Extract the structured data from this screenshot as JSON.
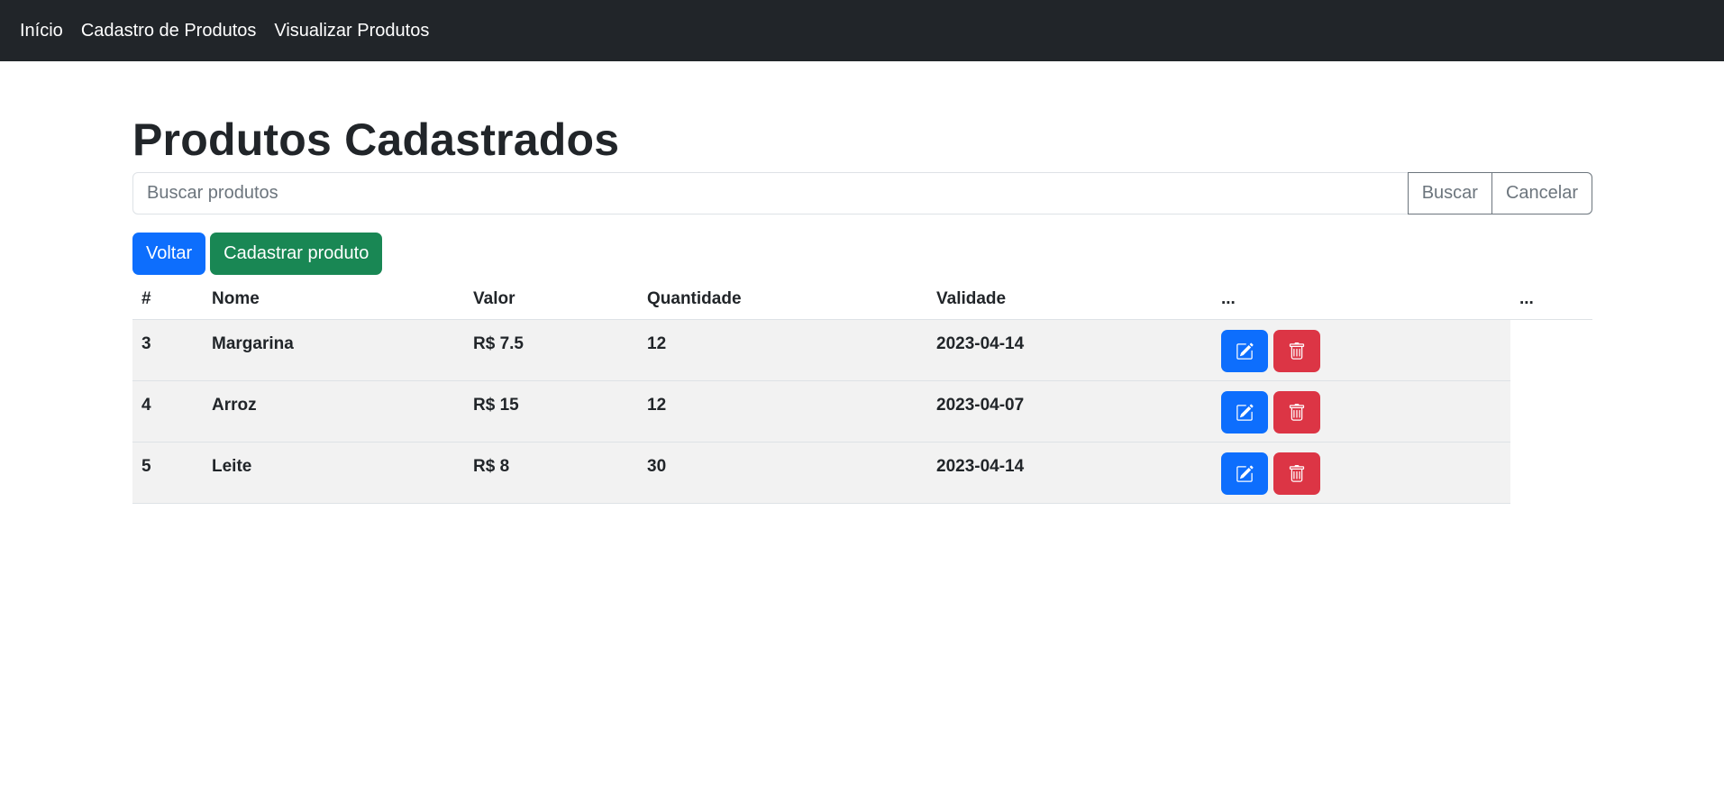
{
  "nav": {
    "items": [
      {
        "label": "Início"
      },
      {
        "label": "Cadastro de Produtos"
      },
      {
        "label": "Visualizar Produtos"
      }
    ]
  },
  "page": {
    "title": "Produtos Cadastrados"
  },
  "search": {
    "placeholder": "Buscar produtos",
    "value": "",
    "search_label": "Buscar",
    "cancel_label": "Cancelar"
  },
  "actions": {
    "back_label": "Voltar",
    "create_label": "Cadastrar produto"
  },
  "table": {
    "headers": [
      "#",
      "Nome",
      "Valor",
      "Quantidade",
      "Validade",
      "...",
      "..."
    ],
    "rows": [
      {
        "id": "3",
        "nome": "Margarina",
        "valor": "R$ 7.5",
        "quantidade": "12",
        "validade": "2023-04-14"
      },
      {
        "id": "4",
        "nome": "Arroz",
        "valor": "R$ 15",
        "quantidade": "12",
        "validade": "2023-04-07"
      },
      {
        "id": "5",
        "nome": "Leite",
        "valor": "R$ 8",
        "quantidade": "30",
        "validade": "2023-04-14"
      }
    ]
  },
  "icons": {
    "edit": "pencil-square-icon",
    "delete": "trash-icon"
  },
  "colors": {
    "navbar": "#212529",
    "primary": "#0d6efd",
    "success": "#198754",
    "danger": "#dc3545",
    "outline": "#6c757d",
    "row_bg": "#f2f2f2"
  }
}
